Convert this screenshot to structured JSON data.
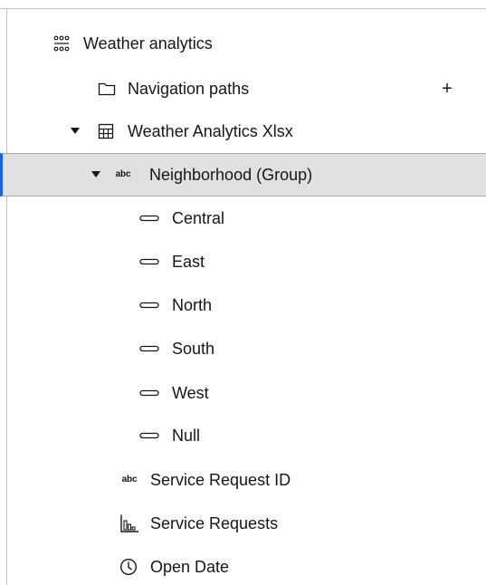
{
  "tree": {
    "root": {
      "label": "Weather analytics",
      "icon": "data-module-icon"
    },
    "navigation_paths": {
      "label": "Navigation paths",
      "icon": "folder-icon",
      "add_label": "+"
    },
    "table": {
      "label": "Weather Analytics Xlsx",
      "icon": "table-icon",
      "expanded": true
    },
    "group": {
      "label": "Neighborhood (Group)",
      "icon_text": "abc",
      "expanded": true,
      "selected": true
    },
    "members": [
      "Central",
      "East",
      "North",
      "South",
      "West",
      "Null"
    ],
    "fields": [
      {
        "label": "Service Request ID",
        "icon": "text-field-icon",
        "icon_text": "abc"
      },
      {
        "label": "Service Requests",
        "icon": "measure-icon"
      },
      {
        "label": "Open Date",
        "icon": "clock-icon"
      }
    ]
  },
  "colors": {
    "selection_bg": "#e0e0e0",
    "selection_accent": "#0f62fe",
    "text": "#161616"
  }
}
